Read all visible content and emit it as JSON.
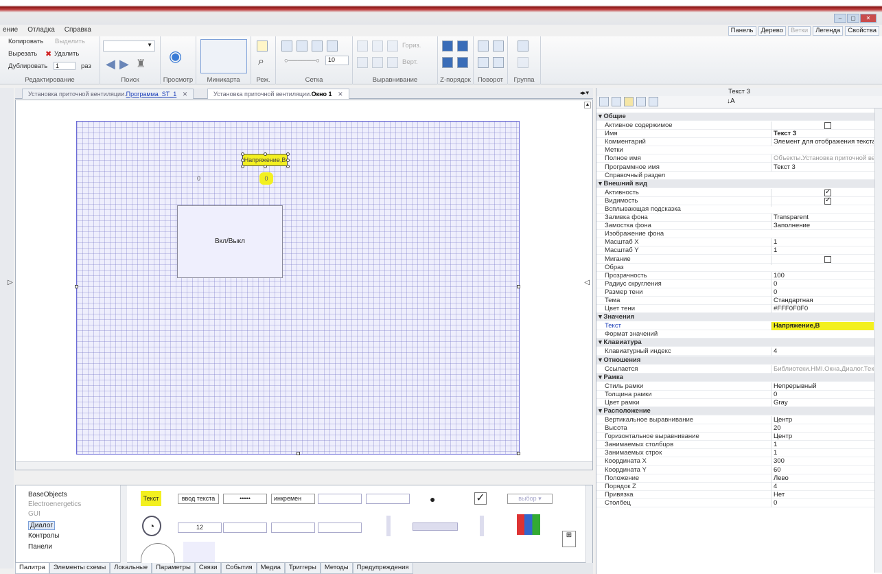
{
  "window": {
    "minimize": "–",
    "restore": "▢",
    "close": "✕"
  },
  "menu": [
    "ение",
    "Отладка",
    "Справка"
  ],
  "panels": [
    "Панель",
    "Дерево",
    "Ветки",
    "Легенда",
    "Свойства"
  ],
  "ribbon": {
    "edit": {
      "copy": "Копировать",
      "select": "Выделить",
      "cut": "Вырезать",
      "delete": "Удалить",
      "duplicate": "Дублировать",
      "dup_count": "1",
      "times": "раз",
      "label": "Редактирование"
    },
    "search": {
      "label": "Поиск"
    },
    "preview": {
      "label": "Просмотр"
    },
    "minimap": {
      "label": "Миникарта"
    },
    "mode": {
      "label": "Реж."
    },
    "grid": {
      "value": "10",
      "label": "Сетка"
    },
    "align": {
      "horiz": "Гориз.",
      "vert": "Верт.",
      "label": "Выравнивание"
    },
    "zorder": {
      "label": "Z-порядок"
    },
    "rotate": {
      "label": "Поворот"
    },
    "group": {
      "label": "Группа"
    }
  },
  "tabs": [
    {
      "prefix": "Установка приточной вентиляции.",
      "name": "Программа_ST_1",
      "close": "✕"
    },
    {
      "prefix": "Установка приточной вентиляции.",
      "name": "Окно 1",
      "close": "✕"
    }
  ],
  "canvas": {
    "selected_text": "Напряжение,В",
    "value_left": "0",
    "value_right": "0",
    "button_label": "Вкл/Выкл"
  },
  "palette": {
    "tree": [
      "BaseObjects",
      "Electroenergetics",
      "GUI",
      "Диалог",
      "Контролы",
      "Панели"
    ],
    "items": {
      "text": "Текст",
      "input": "ввод текста",
      "password": "•••••",
      "increment": "инкремен",
      "choice": "выбор",
      "date": "12"
    }
  },
  "bottom_tabs": [
    "Палитра",
    "Элементы схемы",
    "Локальные",
    "Параметры",
    "Связи",
    "События",
    "Медиа",
    "Триггеры",
    "Методы",
    "Предупреждения"
  ],
  "properties": {
    "title": "Текст 3",
    "rows": [
      {
        "cat": "Общие"
      },
      {
        "k": "Активное содержимое",
        "chk": false
      },
      {
        "k": "Имя",
        "v": "Текст 3",
        "bold": true
      },
      {
        "k": "Комментарий",
        "v": "Элемент для отображения текста"
      },
      {
        "k": "Метки",
        "v": ""
      },
      {
        "k": "Полное имя",
        "v": "Объекты.Установка приточной ве",
        "gray": true
      },
      {
        "k": "Программное имя",
        "v": "Текст 3"
      },
      {
        "k": "Справочный раздел",
        "v": ""
      },
      {
        "cat": "Внешний вид"
      },
      {
        "k": "Активность",
        "chk": true
      },
      {
        "k": "Видимость",
        "chk": true
      },
      {
        "k": "Всплывающая подсказка",
        "v": ""
      },
      {
        "k": "Заливка фона",
        "v": "Transparent"
      },
      {
        "k": "Замостка фона",
        "v": "Заполнение"
      },
      {
        "k": "Изображение фона",
        "v": ""
      },
      {
        "k": "Масштаб X",
        "v": "1"
      },
      {
        "k": "Масштаб Y",
        "v": "1"
      },
      {
        "k": "Мигание",
        "chk": false
      },
      {
        "k": "Образ",
        "v": ""
      },
      {
        "k": "Прозрачность",
        "v": "100"
      },
      {
        "k": "Радиус скругления",
        "v": "0"
      },
      {
        "k": "Размер тени",
        "v": "0"
      },
      {
        "k": "Тема",
        "v": "Стандартная"
      },
      {
        "k": "Цвет тени",
        "v": "#FFF0F0F0"
      },
      {
        "cat": "Значения"
      },
      {
        "k": "Текст",
        "v": "Напряжение,В",
        "hl": true
      },
      {
        "k": "Формат значений",
        "v": ""
      },
      {
        "cat": "Клавиатура"
      },
      {
        "k": "Клавиатурный индекс",
        "v": "4"
      },
      {
        "cat": "Отношения"
      },
      {
        "k": "Ссылается",
        "v": "Библиотеки.HMI.Окна.Диалог.Текс",
        "gray": true
      },
      {
        "cat": "Рамка"
      },
      {
        "k": "Стиль рамки",
        "v": "Непрерывный"
      },
      {
        "k": "Толщина рамки",
        "v": "0"
      },
      {
        "k": "Цвет рамки",
        "v": "Gray"
      },
      {
        "cat": "Расположение"
      },
      {
        "k": "Вертикальное выравнивание",
        "v": "Центр"
      },
      {
        "k": "Высота",
        "v": "20"
      },
      {
        "k": "Горизонтальное выравнивание",
        "v": "Центр"
      },
      {
        "k": "Занимаемых столбцов",
        "v": "1"
      },
      {
        "k": "Занимаемых строк",
        "v": "1"
      },
      {
        "k": "Координата X",
        "v": "300"
      },
      {
        "k": "Координата Y",
        "v": "60"
      },
      {
        "k": "Положение",
        "v": "Лево"
      },
      {
        "k": "Порядок Z",
        "v": "4"
      },
      {
        "k": "Привязка",
        "v": "Нет"
      },
      {
        "k": "Столбец",
        "v": "0"
      }
    ]
  }
}
